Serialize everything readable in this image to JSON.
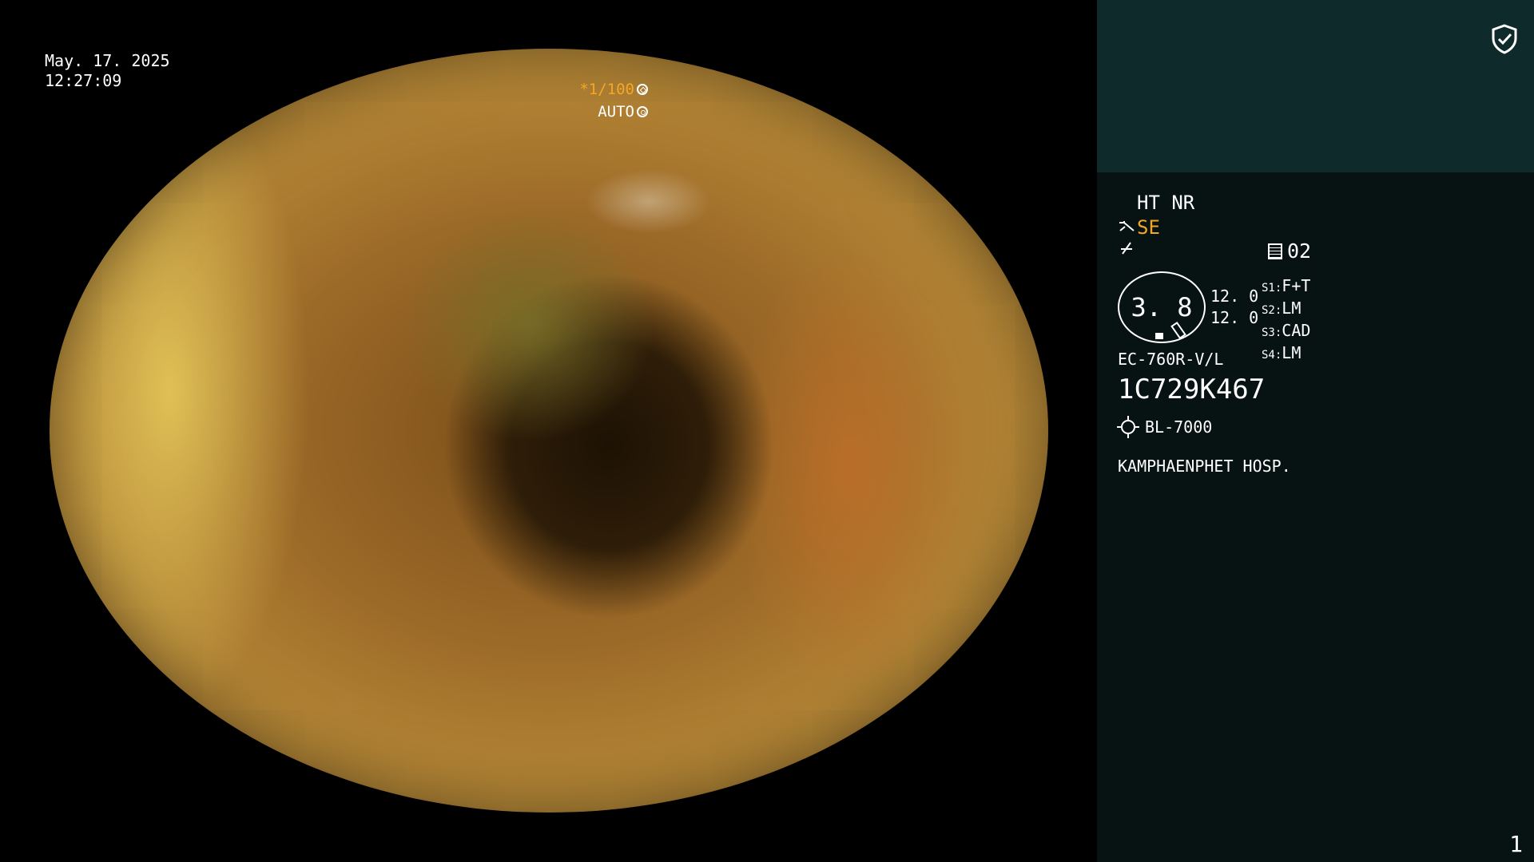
{
  "overlay": {
    "date": "May. 17. 2025",
    "time": "12:27:09",
    "shutter": "*1/100",
    "iris": "AUTO"
  },
  "panel": {
    "ht_nr": "HT NR",
    "se": "SE",
    "memory": "02",
    "gauge_value": "3. 8",
    "val1": "12. 0",
    "val2": "12. 0",
    "s_settings": [
      {
        "key": "S1",
        "value": "F+T"
      },
      {
        "key": "S2",
        "value": "LM"
      },
      {
        "key": "S3",
        "value": "CAD"
      },
      {
        "key": "S4",
        "value": "LM"
      }
    ],
    "scope_model": "EC-760R-V/L",
    "serial": "1C729K467",
    "light_source": "BL-7000",
    "hospital": "KAMPHAENPHET HOSP.",
    "page_number": "1"
  },
  "colors": {
    "accent_orange": "#f5a623",
    "panel_top": "#0e2a2a",
    "panel_bg": "#071212"
  }
}
